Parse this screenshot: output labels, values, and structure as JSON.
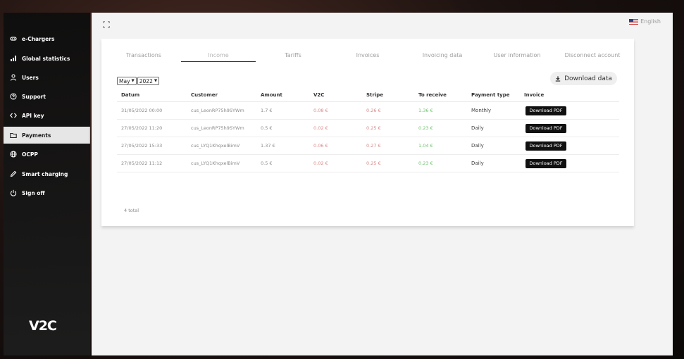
{
  "sidebar": {
    "items": [
      {
        "label": "e-Chargers",
        "icon": "charger-icon"
      },
      {
        "label": "Global statistics",
        "icon": "bar-chart-icon"
      },
      {
        "label": "Users",
        "icon": "user-icon"
      },
      {
        "label": "Support",
        "icon": "help-circle-icon"
      },
      {
        "label": "API key",
        "icon": "code-icon"
      },
      {
        "label": "Payments",
        "icon": "folder-icon"
      },
      {
        "label": "OCPP",
        "icon": "globe-icon"
      },
      {
        "label": "Smart charging",
        "icon": "pen-icon"
      },
      {
        "label": "Sign off",
        "icon": "power-icon"
      }
    ],
    "active": "Payments",
    "logo": "V2C"
  },
  "header": {
    "language": "English"
  },
  "tabs": [
    "Transactions",
    "Income",
    "Tariffs",
    "Invoices",
    "Invoicing data",
    "User information",
    "Disconnect account"
  ],
  "active_tab": "Income",
  "filters": {
    "month": "May",
    "year": "2022"
  },
  "download_data_label": "Download data",
  "table": {
    "columns": [
      "Datum",
      "Customer",
      "Amount",
      "V2C",
      "Stripe",
      "To receive",
      "Payment type",
      "Invoice"
    ],
    "rows": [
      {
        "datum": "31/05/2022 00:00",
        "customer": "cus_LeonRP75h9SYWm",
        "amount": "1.7 €",
        "v2c": "0.08 €",
        "stripe": "0.26 €",
        "to_receive": "1.36 €",
        "payment_type": "Monthly",
        "invoice": "Download PDF"
      },
      {
        "datum": "27/05/2022 11:20",
        "customer": "cus_LeonRP75h9SYWm",
        "amount": "0.5 €",
        "v2c": "0.02 €",
        "stripe": "0.25 €",
        "to_receive": "0.23 €",
        "payment_type": "Daily",
        "invoice": "Download PDF"
      },
      {
        "datum": "27/05/2022 15:33",
        "customer": "cus_LYQ1KhqxelBimV",
        "amount": "1.37 €",
        "v2c": "0.06 €",
        "stripe": "0.27 €",
        "to_receive": "1.04 €",
        "payment_type": "Daily",
        "invoice": "Download PDF"
      },
      {
        "datum": "27/05/2022 11:12",
        "customer": "cus_LYQ1KhqxelBimV",
        "amount": "0.5 €",
        "v2c": "0.02 €",
        "stripe": "0.25 €",
        "to_receive": "0.23 €",
        "payment_type": "Daily",
        "invoice": "Download PDF"
      }
    ],
    "total_label": "4 total"
  },
  "colors": {
    "negative": "#d98a8a",
    "positive": "#6cc36c",
    "sidebar_bg": "#141414",
    "active_nav_bg": "#e6e6e6"
  }
}
